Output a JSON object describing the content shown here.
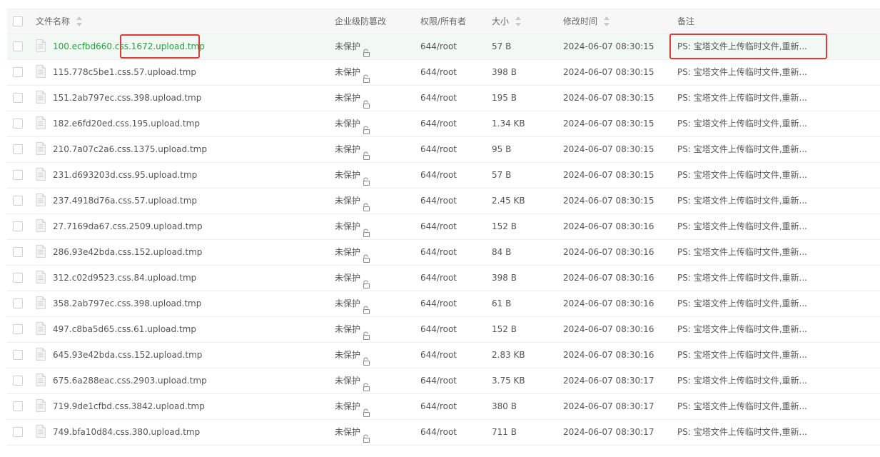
{
  "header": {
    "name": "文件名称",
    "protection": "企业级防篡改",
    "permission": "权限/所有者",
    "size": "大小",
    "mtime": "修改时间",
    "note": "备注"
  },
  "icons": {
    "file": "file-icon",
    "lock": "lock-icon",
    "sort": "sort-icon",
    "checkbox": "checkbox-icon"
  },
  "colors": {
    "accent": "#20a53a",
    "highlight": "#e53935",
    "selected_row_bg": "#f2f8f4"
  },
  "rows": [
    {
      "name": "100.ecfbd660.css.1672.upload.tmp",
      "protection": "未保护",
      "permission": "644/root",
      "size": "57 B",
      "mtime": "2024-06-07 08:30:15",
      "note": "PS: 宝塔文件上传临时文件,重新..."
    },
    {
      "name": "115.778c5be1.css.57.upload.tmp",
      "protection": "未保护",
      "permission": "644/root",
      "size": "398 B",
      "mtime": "2024-06-07 08:30:15",
      "note": "PS: 宝塔文件上传临时文件,重新..."
    },
    {
      "name": "151.2ab797ec.css.398.upload.tmp",
      "protection": "未保护",
      "permission": "644/root",
      "size": "195 B",
      "mtime": "2024-06-07 08:30:15",
      "note": "PS: 宝塔文件上传临时文件,重新..."
    },
    {
      "name": "182.e6fd20ed.css.195.upload.tmp",
      "protection": "未保护",
      "permission": "644/root",
      "size": "1.34 KB",
      "mtime": "2024-06-07 08:30:15",
      "note": "PS: 宝塔文件上传临时文件,重新..."
    },
    {
      "name": "210.7a07c2a6.css.1375.upload.tmp",
      "protection": "未保护",
      "permission": "644/root",
      "size": "95 B",
      "mtime": "2024-06-07 08:30:15",
      "note": "PS: 宝塔文件上传临时文件,重新..."
    },
    {
      "name": "231.d693203d.css.95.upload.tmp",
      "protection": "未保护",
      "permission": "644/root",
      "size": "57 B",
      "mtime": "2024-06-07 08:30:15",
      "note": "PS: 宝塔文件上传临时文件,重新..."
    },
    {
      "name": "237.4918d76a.css.57.upload.tmp",
      "protection": "未保护",
      "permission": "644/root",
      "size": "2.45 KB",
      "mtime": "2024-06-07 08:30:15",
      "note": "PS: 宝塔文件上传临时文件,重新..."
    },
    {
      "name": "27.7169da67.css.2509.upload.tmp",
      "protection": "未保护",
      "permission": "644/root",
      "size": "152 B",
      "mtime": "2024-06-07 08:30:16",
      "note": "PS: 宝塔文件上传临时文件,重新..."
    },
    {
      "name": "286.93e42bda.css.152.upload.tmp",
      "protection": "未保护",
      "permission": "644/root",
      "size": "84 B",
      "mtime": "2024-06-07 08:30:16",
      "note": "PS: 宝塔文件上传临时文件,重新..."
    },
    {
      "name": "312.c02d9523.css.84.upload.tmp",
      "protection": "未保护",
      "permission": "644/root",
      "size": "398 B",
      "mtime": "2024-06-07 08:30:16",
      "note": "PS: 宝塔文件上传临时文件,重新..."
    },
    {
      "name": "358.2ab797ec.css.398.upload.tmp",
      "protection": "未保护",
      "permission": "644/root",
      "size": "61 B",
      "mtime": "2024-06-07 08:30:16",
      "note": "PS: 宝塔文件上传临时文件,重新..."
    },
    {
      "name": "497.c8ba5d65.css.61.upload.tmp",
      "protection": "未保护",
      "permission": "644/root",
      "size": "152 B",
      "mtime": "2024-06-07 08:30:16",
      "note": "PS: 宝塔文件上传临时文件,重新..."
    },
    {
      "name": "645.93e42bda.css.152.upload.tmp",
      "protection": "未保护",
      "permission": "644/root",
      "size": "2.83 KB",
      "mtime": "2024-06-07 08:30:16",
      "note": "PS: 宝塔文件上传临时文件,重新..."
    },
    {
      "name": "675.6a288eac.css.2903.upload.tmp",
      "protection": "未保护",
      "permission": "644/root",
      "size": "3.75 KB",
      "mtime": "2024-06-07 08:30:17",
      "note": "PS: 宝塔文件上传临时文件,重新..."
    },
    {
      "name": "719.9de1cfbd.css.3842.upload.tmp",
      "protection": "未保护",
      "permission": "644/root",
      "size": "380 B",
      "mtime": "2024-06-07 08:30:17",
      "note": "PS: 宝塔文件上传临时文件,重新..."
    },
    {
      "name": "749.bfa10d84.css.380.upload.tmp",
      "protection": "未保护",
      "permission": "644/root",
      "size": "711 B",
      "mtime": "2024-06-07 08:30:17",
      "note": "PS: 宝塔文件上传临时文件,重新..."
    }
  ]
}
